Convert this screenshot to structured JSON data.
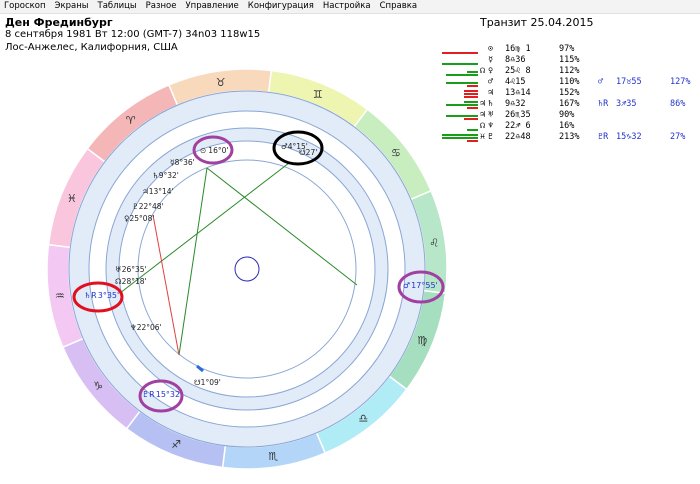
{
  "menu": [
    "Гороскоп",
    "Экраны",
    "Таблицы",
    "Разное",
    "Управление",
    "Конфигурация",
    "Настройка",
    "Справка"
  ],
  "person": {
    "name": "Ден Фрединбург",
    "birth_line": "8 сентября 1981  Вт  12:00 (GMT-7) 34n03  118w15",
    "place": "Лос-Анжелес, Калифорния, США"
  },
  "transit": "Транзит 25.04.2015",
  "colors": {
    "green_bar": "#1a9e1a",
    "red_bar": "#e02020",
    "transit_text": "#2233cc",
    "highlight_purple": "#a040a0",
    "highlight_red": "#e01020",
    "highlight_black": "#000000"
  },
  "planets": [
    {
      "aspect": "",
      "glyph": "⊙",
      "pos": "16♍ 1",
      "pct": "97%",
      "green": [
        0
      ],
      "red": [
        1
      ],
      "tr_glyph": "",
      "tr_pos": "",
      "tr_pct": ""
    },
    {
      "aspect": "",
      "glyph": "☿",
      "pos": "8♎36",
      "pct": "115%",
      "green": [
        1
      ],
      "red": [],
      "tr_glyph": "",
      "tr_pos": "",
      "tr_pct": ""
    },
    {
      "aspect": "☊",
      "glyph": "♀",
      "pos": "25♌ 8",
      "pct": "112%",
      "green": [
        0.9,
        0.3
      ],
      "red": [],
      "tr_glyph": "",
      "tr_pos": "",
      "tr_pct": ""
    },
    {
      "aspect": "",
      "glyph": "♂",
      "pos": "4♌15",
      "pct": "110%",
      "green": [
        0.9
      ],
      "red": [
        0.3
      ],
      "tr_glyph": "♂",
      "tr_pos": "17♉55",
      "tr_pct": "127%"
    },
    {
      "aspect": "",
      "glyph": "♃",
      "pos": "13♎14",
      "pct": "152%",
      "green": [],
      "red": [
        0.4,
        0.4,
        0.4
      ],
      "tr_glyph": "",
      "tr_pos": "",
      "tr_pct": ""
    },
    {
      "aspect": "♃",
      "glyph": "♄",
      "pos": "9♎32",
      "pct": "167%",
      "green": [
        0.9,
        0.4
      ],
      "red": [
        0.3
      ],
      "tr_glyph": "♄R",
      "tr_pos": "3♐35",
      "tr_pct": "86%"
    },
    {
      "aspect": "♃",
      "glyph": "♅",
      "pos": "26♏35",
      "pct": "90%",
      "green": [
        0.9
      ],
      "red": [
        0.4
      ],
      "tr_glyph": "",
      "tr_pos": "",
      "tr_pct": ""
    },
    {
      "aspect": "☊",
      "glyph": "♆",
      "pos": "22♐ 6",
      "pct": "16%",
      "green": [
        0.3
      ],
      "red": [],
      "tr_glyph": "",
      "tr_pos": "",
      "tr_pct": ""
    },
    {
      "aspect": "♓",
      "glyph": "♇",
      "pos": "22♎48",
      "pct": "213%",
      "green": [
        1,
        1
      ],
      "red": [
        0.3
      ],
      "tr_glyph": "♇R",
      "tr_pos": "15♑32",
      "tr_pct": "27%"
    }
  ],
  "zodiac_ring": [
    {
      "glyph": "♈",
      "color": "#f4b6b6"
    },
    {
      "glyph": "♉",
      "color": "#f9d9bc"
    },
    {
      "glyph": "♊",
      "color": "#eef5b0"
    },
    {
      "glyph": "♋",
      "color": "#c8eec0"
    },
    {
      "glyph": "♌",
      "color": "#b7e6c8"
    },
    {
      "glyph": "♍",
      "color": "#a6dfc0"
    },
    {
      "glyph": "♎",
      "color": "#b0ecf6"
    },
    {
      "glyph": "♏",
      "color": "#b3d6f8"
    },
    {
      "glyph": "♐",
      "color": "#b6c0f2"
    },
    {
      "glyph": "♑",
      "color": "#d7bff4"
    },
    {
      "glyph": "♒",
      "color": "#f3c8f3"
    },
    {
      "glyph": "♓",
      "color": "#f9c6de"
    }
  ],
  "natal_labels": [
    {
      "text": "16°0'",
      "glyph": "⊙"
    },
    {
      "text": "8°36'",
      "glyph": "☿"
    },
    {
      "text": "9°32'",
      "glyph": "♄"
    },
    {
      "text": "13°14'",
      "glyph": "♃"
    },
    {
      "text": "22°48'",
      "glyph": "♇"
    },
    {
      "text": "25°08'",
      "glyph": "♀"
    },
    {
      "text": "26°35'",
      "glyph": "♅"
    },
    {
      "text": "28°18'",
      "glyph": "☊"
    },
    {
      "text": "22°06'",
      "glyph": "♆"
    },
    {
      "text": "1°09'",
      "glyph": "☋"
    },
    {
      "text": "4°15'",
      "glyph": "♂"
    },
    {
      "text": "27'",
      "glyph": "☋"
    }
  ],
  "transit_labels": [
    {
      "text": "3°35'",
      "glyph": "♄R"
    },
    {
      "text": "17°55'",
      "glyph": "♂"
    },
    {
      "text": "15°32'",
      "glyph": "♇R"
    }
  ]
}
